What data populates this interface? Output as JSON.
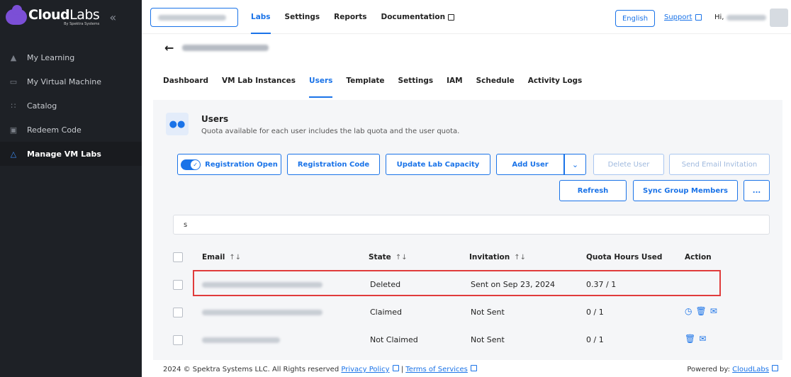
{
  "sidebar": {
    "logo_main": "Cloud",
    "logo_main_light": "Labs",
    "logo_sub": "By Spektra Systems",
    "collapse_icon": "chevron-left-icon",
    "items": [
      {
        "label": "My Learning",
        "icon": "graduation-cap-icon"
      },
      {
        "label": "My Virtual Machine",
        "icon": "monitor-icon"
      },
      {
        "label": "Catalog",
        "icon": "grid-icon"
      },
      {
        "label": "Redeem Code",
        "icon": "ticket-icon"
      },
      {
        "label": "Manage VM Labs",
        "icon": "flask-icon",
        "active": true
      }
    ]
  },
  "topbar": {
    "nav": [
      "Labs",
      "Settings",
      "Reports",
      "Documentation"
    ],
    "language": "English",
    "support": "Support",
    "greeting": "Hi,"
  },
  "tabs": [
    "Dashboard",
    "VM Lab Instances",
    "Users",
    "Template",
    "Settings",
    "IAM",
    "Schedule",
    "Activity Logs"
  ],
  "users_panel": {
    "title": "Users",
    "subtitle": "Quota available for each user includes the lab quota and the user quota.",
    "buttons": {
      "registration_open": "Registration Open",
      "registration_code": "Registration Code",
      "update_capacity": "Update Lab Capacity",
      "add_user": "Add User",
      "delete_user": "Delete User",
      "send_invitation": "Send Email Invitation",
      "refresh": "Refresh",
      "sync_group": "Sync Group Members",
      "more": "..."
    },
    "search_value": "s"
  },
  "table": {
    "headers": {
      "email": "Email",
      "state": "State",
      "invitation": "Invitation",
      "quota": "Quota Hours Used",
      "action": "Action"
    },
    "sort_glyph": "↑↓",
    "rows": [
      {
        "state": "Deleted",
        "invitation": "Sent on Sep 23, 2024",
        "quota": "0.37 / 1"
      },
      {
        "state": "Claimed",
        "invitation": "Not Sent",
        "quota": "0 / 1"
      },
      {
        "state": "Not Claimed",
        "invitation": "Not Sent",
        "quota": "0 / 1"
      }
    ]
  },
  "footer": {
    "copyright": "2024 © Spektra Systems LLC. All Rights reserved",
    "privacy": "Privacy Policy",
    "separator": "|",
    "terms": "Terms of Services",
    "powered_by": "Powered by:",
    "powered_link": "CloudLabs"
  },
  "colors": {
    "accent": "#1a73e8",
    "sidebar_bg": "#1e2126",
    "highlight": "#e03c3c",
    "brand": "#7b4fd6"
  }
}
